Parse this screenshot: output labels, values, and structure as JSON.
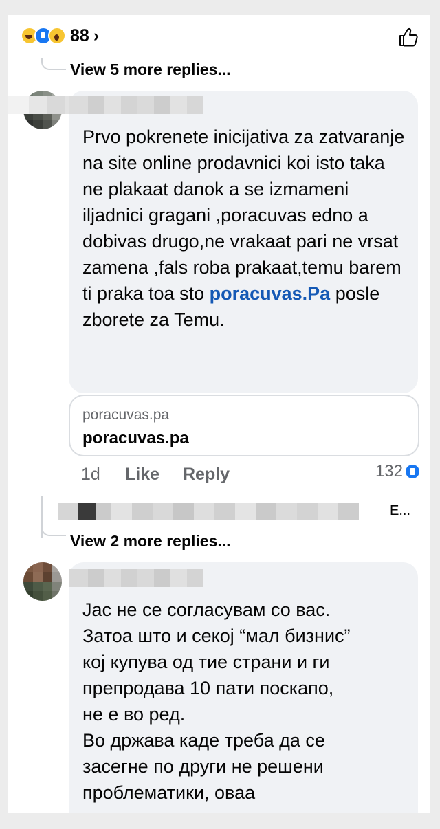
{
  "reactions": {
    "count": "88",
    "chevron": "›",
    "icons": [
      "haha-icon",
      "like-icon",
      "wow-icon"
    ]
  },
  "thread1": {
    "view_more": "View 5 more replies..."
  },
  "comment1": {
    "text_before_link": "Prvo pokrenete inicijativa za zatvaranje na site online prodavnici koi isto taka ne plakaat danok a se izmameni iljadnici gragani ,poracuvas edno a dobivas drugo,ne vrakaat pari ne vrsat zamena ,fals roba prakaat,temu barem ti praka toa sto ",
    "link_text": "poracuvas.Pa",
    "text_after_link": " posle zborete za Temu.",
    "preview": {
      "domain": "poracuvas.pa",
      "title": "poracuvas.pa"
    },
    "time": "1d",
    "like_label": "Like",
    "reply_label": "Reply",
    "like_count": "132"
  },
  "reply_preview": {
    "truncated_text": "E..."
  },
  "thread2": {
    "view_more": "View 2 more replies..."
  },
  "comment2": {
    "lines": [
      "Јас не се согласувам со вас.",
      "Затоа што и секој “мал бизнис”",
      "кој купува од тие страни и ги",
      "препродава 10 пати поскапо,",
      "не е во ред.",
      "Во држава каде треба да се",
      "засегне по други не решени",
      "проблематики, оваа"
    ]
  },
  "colors": {
    "link": "#1559b5",
    "reaction_blue": "#1877f2",
    "bubble": "#f0f2f5",
    "meta": "#65676b"
  }
}
